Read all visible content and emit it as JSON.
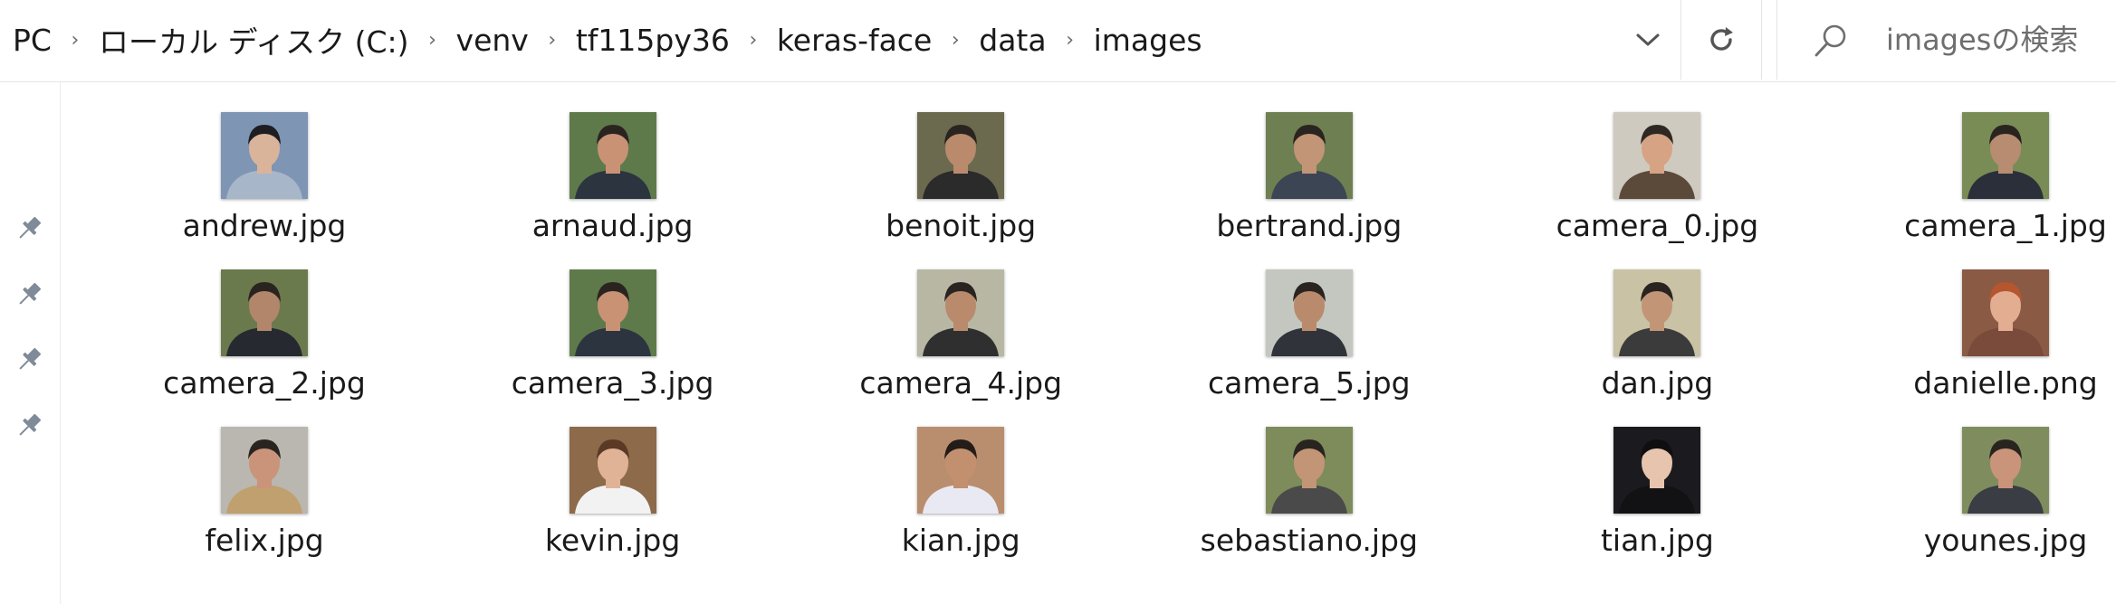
{
  "breadcrumb": {
    "items": [
      "PC",
      "ローカル ディスク (C:)",
      "venv",
      "tf115py36",
      "keras-face",
      "data",
      "images"
    ],
    "separator": "›"
  },
  "search": {
    "placeholder": "imagesの検索"
  },
  "icons": {
    "address_dropdown": "chevron-down-icon",
    "refresh": "refresh-icon",
    "search": "search-icon",
    "pin": "pin-icon"
  },
  "files": [
    {
      "name": "andrew.jpg",
      "thumb": {
        "bg": "#7f95b4",
        "skin": "#d9b49a",
        "hair": "#1d1d22",
        "shirt": "#a8b6c9"
      }
    },
    {
      "name": "arnaud.jpg",
      "thumb": {
        "bg": "#5f7a4a",
        "skin": "#c99274",
        "hair": "#2a2420",
        "shirt": "#2c3440"
      }
    },
    {
      "name": "benoit.jpg",
      "thumb": {
        "bg": "#6b6a4f",
        "skin": "#b98a6c",
        "hair": "#2a2420",
        "shirt": "#2b2b2b"
      }
    },
    {
      "name": "bertrand.jpg",
      "thumb": {
        "bg": "#6e7f52",
        "skin": "#c29577",
        "hair": "#2a2420",
        "shirt": "#3b4553"
      }
    },
    {
      "name": "camera_0.jpg",
      "thumb": {
        "bg": "#cfcac0",
        "skin": "#d6a385",
        "hair": "#2e2823",
        "shirt": "#5b4a3a"
      }
    },
    {
      "name": "camera_1.jpg",
      "thumb": {
        "bg": "#7a8c56",
        "skin": "#b88c70",
        "hair": "#2a2420",
        "shirt": "#2a2f3a"
      }
    },
    {
      "name": "camera_2.jpg",
      "thumb": {
        "bg": "#6b7a4c",
        "skin": "#b2866a",
        "hair": "#2a2420",
        "shirt": "#262a30"
      }
    },
    {
      "name": "camera_3.jpg",
      "thumb": {
        "bg": "#5f7a4a",
        "skin": "#c99274",
        "hair": "#2a2420",
        "shirt": "#2c3440"
      }
    },
    {
      "name": "camera_4.jpg",
      "thumb": {
        "bg": "#b8b7a4",
        "skin": "#b98a6c",
        "hair": "#2a2420",
        "shirt": "#2f2f2f"
      }
    },
    {
      "name": "camera_5.jpg",
      "thumb": {
        "bg": "#c3c7c0",
        "skin": "#b98a6c",
        "hair": "#2a2420",
        "shirt": "#30343a"
      }
    },
    {
      "name": "dan.jpg",
      "thumb": {
        "bg": "#c9c2a4",
        "skin": "#c29577",
        "hair": "#2a2420",
        "shirt": "#3b3b3b"
      }
    },
    {
      "name": "danielle.png",
      "thumb": {
        "bg": "#8a5a44",
        "skin": "#e3ad92",
        "hair": "#b5562f",
        "shirt": "#7a4a3a"
      }
    },
    {
      "name": "felix.jpg",
      "thumb": {
        "bg": "#b9b7b0",
        "skin": "#c99479",
        "hair": "#2a2420",
        "shirt": "#c0a06e"
      }
    },
    {
      "name": "kevin.jpg",
      "thumb": {
        "bg": "#8c6a4a",
        "skin": "#e0b396",
        "hair": "#5a3a24",
        "shirt": "#f2f2f2"
      }
    },
    {
      "name": "kian.jpg",
      "thumb": {
        "bg": "#b98e6f",
        "skin": "#c2906e",
        "hair": "#241c18",
        "shirt": "#e9e9f3"
      }
    },
    {
      "name": "sebastiano.jpg",
      "thumb": {
        "bg": "#7d8c5a",
        "skin": "#c29577",
        "hair": "#2a2420",
        "shirt": "#4a4a4a"
      }
    },
    {
      "name": "tian.jpg",
      "thumb": {
        "bg": "#1b1b1f",
        "skin": "#e7c4ad",
        "hair": "#0f0f12",
        "shirt": "#121214"
      }
    },
    {
      "name": "younes.jpg",
      "thumb": {
        "bg": "#7f8d5e",
        "skin": "#c99479",
        "hair": "#2a2420",
        "shirt": "#3a3d44"
      }
    }
  ]
}
